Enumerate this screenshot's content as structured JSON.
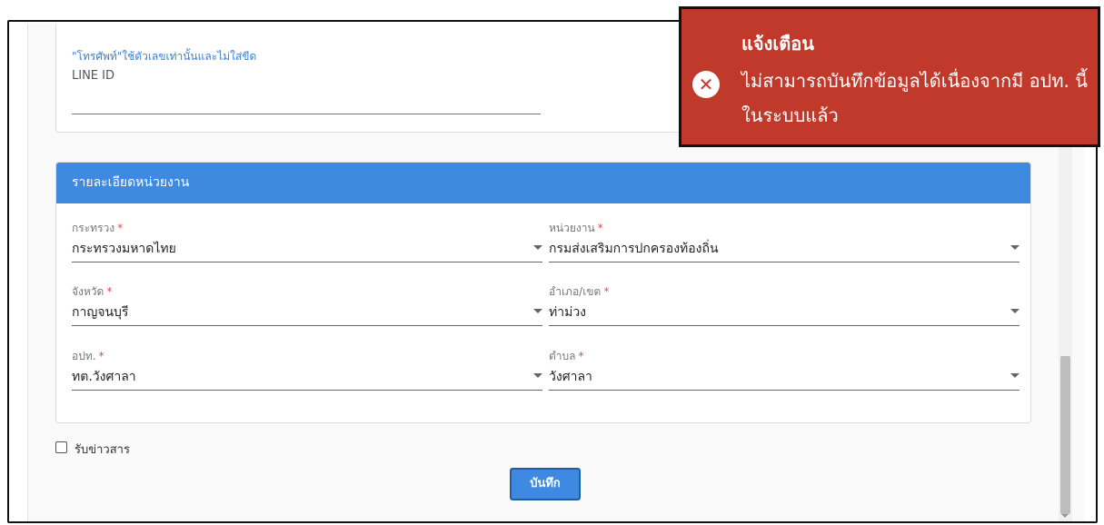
{
  "contact": {
    "phone_hint": "\"โทรศัพท์\"ใช้ตัวเลขเท่านั้นและไม่ใส่ขีด",
    "line_id_label": "LINE ID",
    "line_id_value": ""
  },
  "agency": {
    "header": "รายละเอียดหน่วยงาน",
    "required_mark": "*",
    "ministry": {
      "label": "กระทรวง",
      "value": "กระทรวงมหาดไทย"
    },
    "department": {
      "label": "หน่วยงาน",
      "value": "กรมส่งเสริมการปกครองท้องถิ่น"
    },
    "province": {
      "label": "จังหวัด",
      "value": "กาญจนบุรี"
    },
    "district": {
      "label": "อำเภอ/เขต",
      "value": "ท่าม่วง"
    },
    "lao": {
      "label": "อปท.",
      "value": "ทต.วังศาลา"
    },
    "subdistrict": {
      "label": "ตำบล",
      "value": "วังศาลา"
    }
  },
  "newsletter": {
    "label": "รับข่าวสาร",
    "checked": false
  },
  "save_label": "บันทึก",
  "toast": {
    "title": "แจ้งเตือน",
    "message": "ไม่สามารถบันทึกข้อมูลได้เนื่องจากมี อปท. นี้ในระบบแล้ว",
    "icon": "close-circle-icon",
    "color": "#c0392b"
  },
  "colors": {
    "accent": "#3d8ae0",
    "required": "#e54b4b"
  }
}
